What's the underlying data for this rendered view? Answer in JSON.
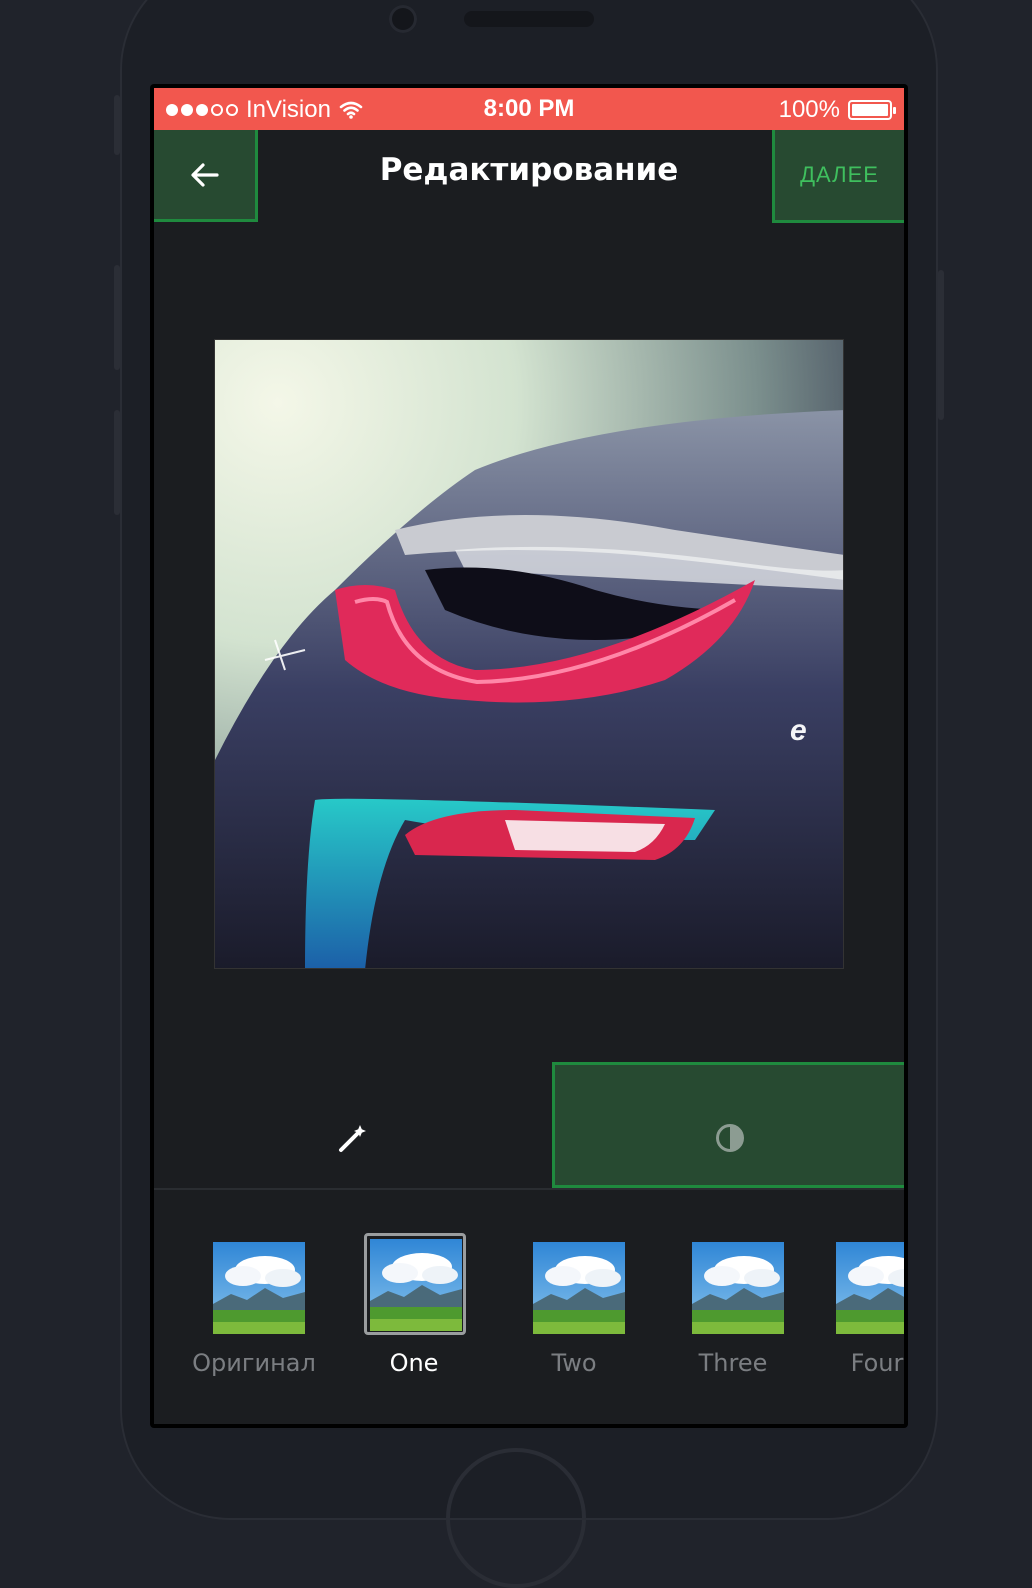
{
  "status_bar": {
    "carrier": "InVision",
    "time": "8:00 PM",
    "battery": "100%",
    "battery_level": 1.0,
    "signal_bars_full": 3,
    "signal_bars_total": 5
  },
  "nav": {
    "back_icon": "arrow-left-icon",
    "title": "Редактирование",
    "next_label": "ДАЛЕЕ"
  },
  "photo": {
    "subject": "car-taillight-photo"
  },
  "tools": {
    "magic_icon": "magic-wand-icon",
    "contrast_icon": "contrast-icon",
    "selected": "contrast"
  },
  "filters": [
    {
      "label": "Оригинал",
      "selected": false
    },
    {
      "label": "One",
      "selected": true
    },
    {
      "label": "Two",
      "selected": false
    },
    {
      "label": "Three",
      "selected": false
    },
    {
      "label": "Four",
      "selected": false
    }
  ],
  "colors": {
    "status_bar": "#f2574e",
    "accent_green": "#1f8a3e",
    "button_fill": "#274a31",
    "next_text": "#3fbf5e",
    "background": "#1b1d20"
  }
}
